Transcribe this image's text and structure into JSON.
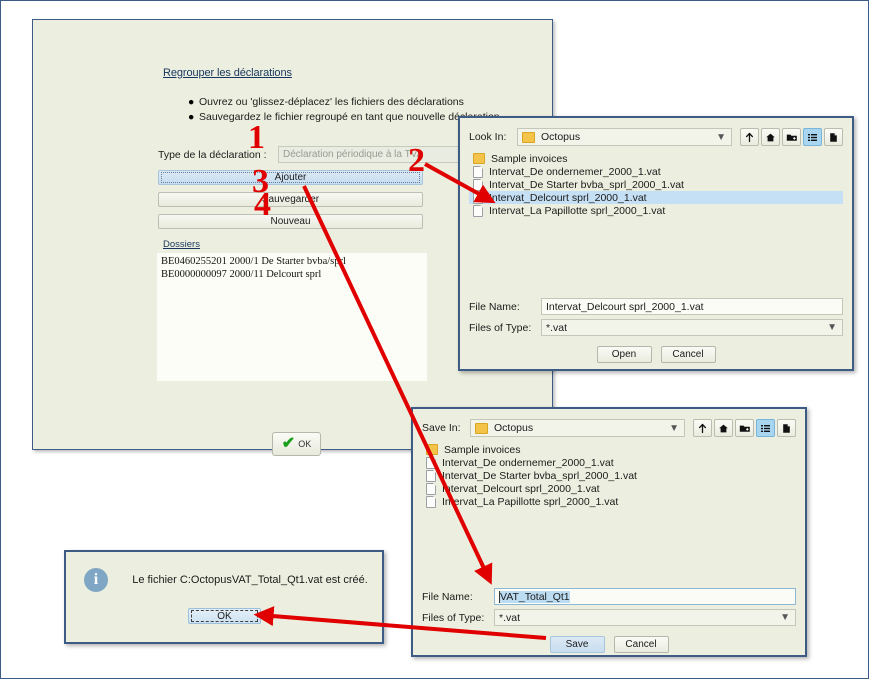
{
  "main_panel": {
    "title": "Regrouper les déclarations",
    "bullets": [
      "Ouvrez ou 'glissez-déplacez' les fichiers des déclarations",
      "Sauvegardez le fichier regroupé en tant que nouvelle déclaration."
    ],
    "type_label": "Type de la déclaration :",
    "type_value": "Déclaration périodique à la TVA",
    "buttons": {
      "add": "Ajouter",
      "save": "Sauvegarder",
      "new": "Nouveau"
    },
    "dossiers_label": "Dossiers",
    "dossiers": [
      "BE0460255201 2000/1 De Starter bvba/sprl",
      "BE0000000097 2000/11 Delcourt sprl"
    ],
    "ok_label": "OK",
    "ok_icon": "green-check-icon"
  },
  "open_dialog": {
    "look_in_label": "Look In:",
    "look_in_value": "Octopus",
    "toolbar_icons": [
      "up-one-level-icon",
      "home-icon",
      "new-folder-icon",
      "list-view-icon",
      "details-view-icon"
    ],
    "files": [
      {
        "name": "Sample invoices",
        "type": "folder",
        "selected": false
      },
      {
        "name": "Intervat_De ondernemer_2000_1.vat",
        "type": "file",
        "selected": false
      },
      {
        "name": "Intervat_De Starter bvba_sprl_2000_1.vat",
        "type": "file",
        "selected": false
      },
      {
        "name": "Intervat_Delcourt sprl_2000_1.vat",
        "type": "file",
        "selected": true
      },
      {
        "name": "Intervat_La Papillotte sprl_2000_1.vat",
        "type": "file",
        "selected": false
      }
    ],
    "file_name_label": "File Name:",
    "file_name_value": "Intervat_Delcourt sprl_2000_1.vat",
    "files_of_type_label": "Files of Type:",
    "files_of_type_value": "*.vat",
    "open_button": "Open",
    "cancel_button": "Cancel"
  },
  "save_dialog": {
    "save_in_label": "Save In:",
    "save_in_value": "Octopus",
    "toolbar_icons": [
      "up-one-level-icon",
      "home-icon",
      "new-folder-icon",
      "list-view-icon",
      "details-view-icon"
    ],
    "files": [
      {
        "name": "Sample invoices",
        "type": "folder",
        "selected": false
      },
      {
        "name": "Intervat_De ondernemer_2000_1.vat",
        "type": "file",
        "selected": false
      },
      {
        "name": "Intervat_De Starter bvba_sprl_2000_1.vat",
        "type": "file",
        "selected": false
      },
      {
        "name": "Intervat_Delcourt sprl_2000_1.vat",
        "type": "file",
        "selected": false
      },
      {
        "name": "Intervat_La Papillotte sprl_2000_1.vat",
        "type": "file",
        "selected": false
      }
    ],
    "file_name_label": "File Name:",
    "file_name_value": "VAT_Total_Qt1",
    "files_of_type_label": "Files of Type:",
    "files_of_type_value": "*.vat",
    "save_button": "Save",
    "cancel_button": "Cancel"
  },
  "message_dialog": {
    "icon": "info-icon",
    "icon_glyph": "i",
    "text": "Le fichier C:OctopusVAT_Total_Qt1.vat est créé.",
    "ok_button": "OK"
  },
  "annotations": {
    "color": "#e00000",
    "steps": [
      {
        "label": "1"
      },
      {
        "label": "2"
      },
      {
        "label": "3"
      },
      {
        "label": "4"
      }
    ]
  },
  "colors": {
    "panel_bg": "#ecefdf",
    "panel_border": "#3c5c86",
    "selection": "#c5e0f5",
    "annotation_red": "#e00000",
    "list_bg": "#fdfdf7"
  }
}
